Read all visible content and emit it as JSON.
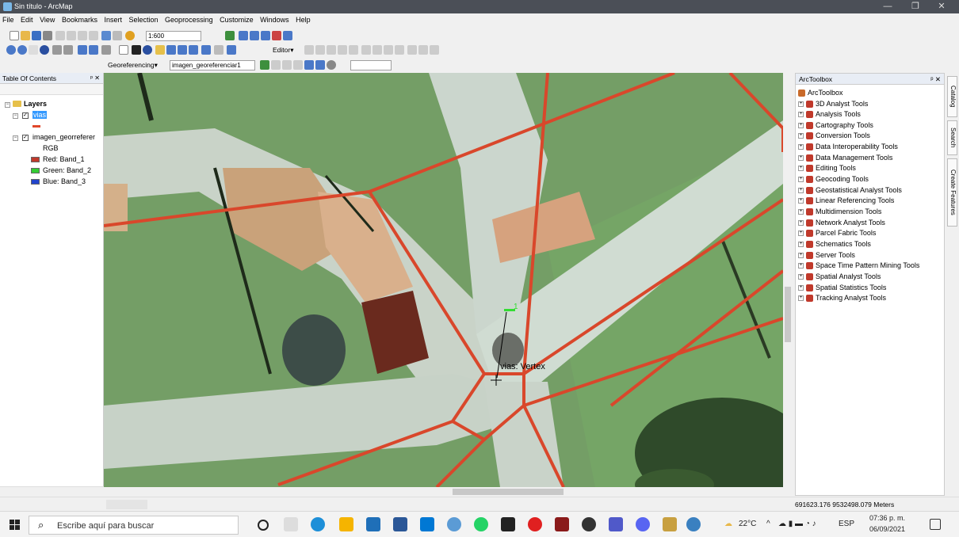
{
  "window": {
    "title": "Sin título - ArcMap",
    "minimize": "—",
    "maximize": "❐",
    "close": "✕"
  },
  "menu": [
    "File",
    "Edit",
    "View",
    "Bookmarks",
    "Insert",
    "Selection",
    "Geoprocessing",
    "Customize",
    "Windows",
    "Help"
  ],
  "toolbar": {
    "scale": "1:600",
    "editor_label": "Editor▾"
  },
  "georef": {
    "label": "Georeferencing▾",
    "layer": "imagen_georeferenciar1"
  },
  "toc": {
    "title": "Table Of Contents",
    "layers_label": "Layers",
    "layer1": "vias",
    "layer2": "imagen_georreferer",
    "rgb": "RGB",
    "bands": [
      {
        "label": "Red:   Band_1",
        "color": "#c0392b"
      },
      {
        "label": "Green: Band_2",
        "color": "#33cc33"
      },
      {
        "label": "Blue:  Band_3",
        "color": "#2244cc"
      }
    ]
  },
  "map": {
    "vertex_label": "vias: Vertex",
    "point_label": "1"
  },
  "arctoolbox": {
    "title": "ArcToolbox",
    "root": "ArcToolbox",
    "tools": [
      "3D Analyst Tools",
      "Analysis Tools",
      "Cartography Tools",
      "Conversion Tools",
      "Data Interoperability Tools",
      "Data Management Tools",
      "Editing Tools",
      "Geocoding Tools",
      "Geostatistical Analyst Tools",
      "Linear Referencing Tools",
      "Multidimension Tools",
      "Network Analyst Tools",
      "Parcel Fabric Tools",
      "Schematics Tools",
      "Server Tools",
      "Space Time Pattern Mining Tools",
      "Spatial Analyst Tools",
      "Spatial Statistics Tools",
      "Tracking Analyst Tools"
    ]
  },
  "sidetabs": [
    "Catalog",
    "Search",
    "Create Features"
  ],
  "status": {
    "coords": "691623.176  9532498.079 Meters"
  },
  "taskbar": {
    "search_placeholder": "Escribe aquí para buscar",
    "temp": "22°C",
    "lang": "ESP",
    "time": "07:36 p. m.",
    "date": "06/09/2021"
  }
}
